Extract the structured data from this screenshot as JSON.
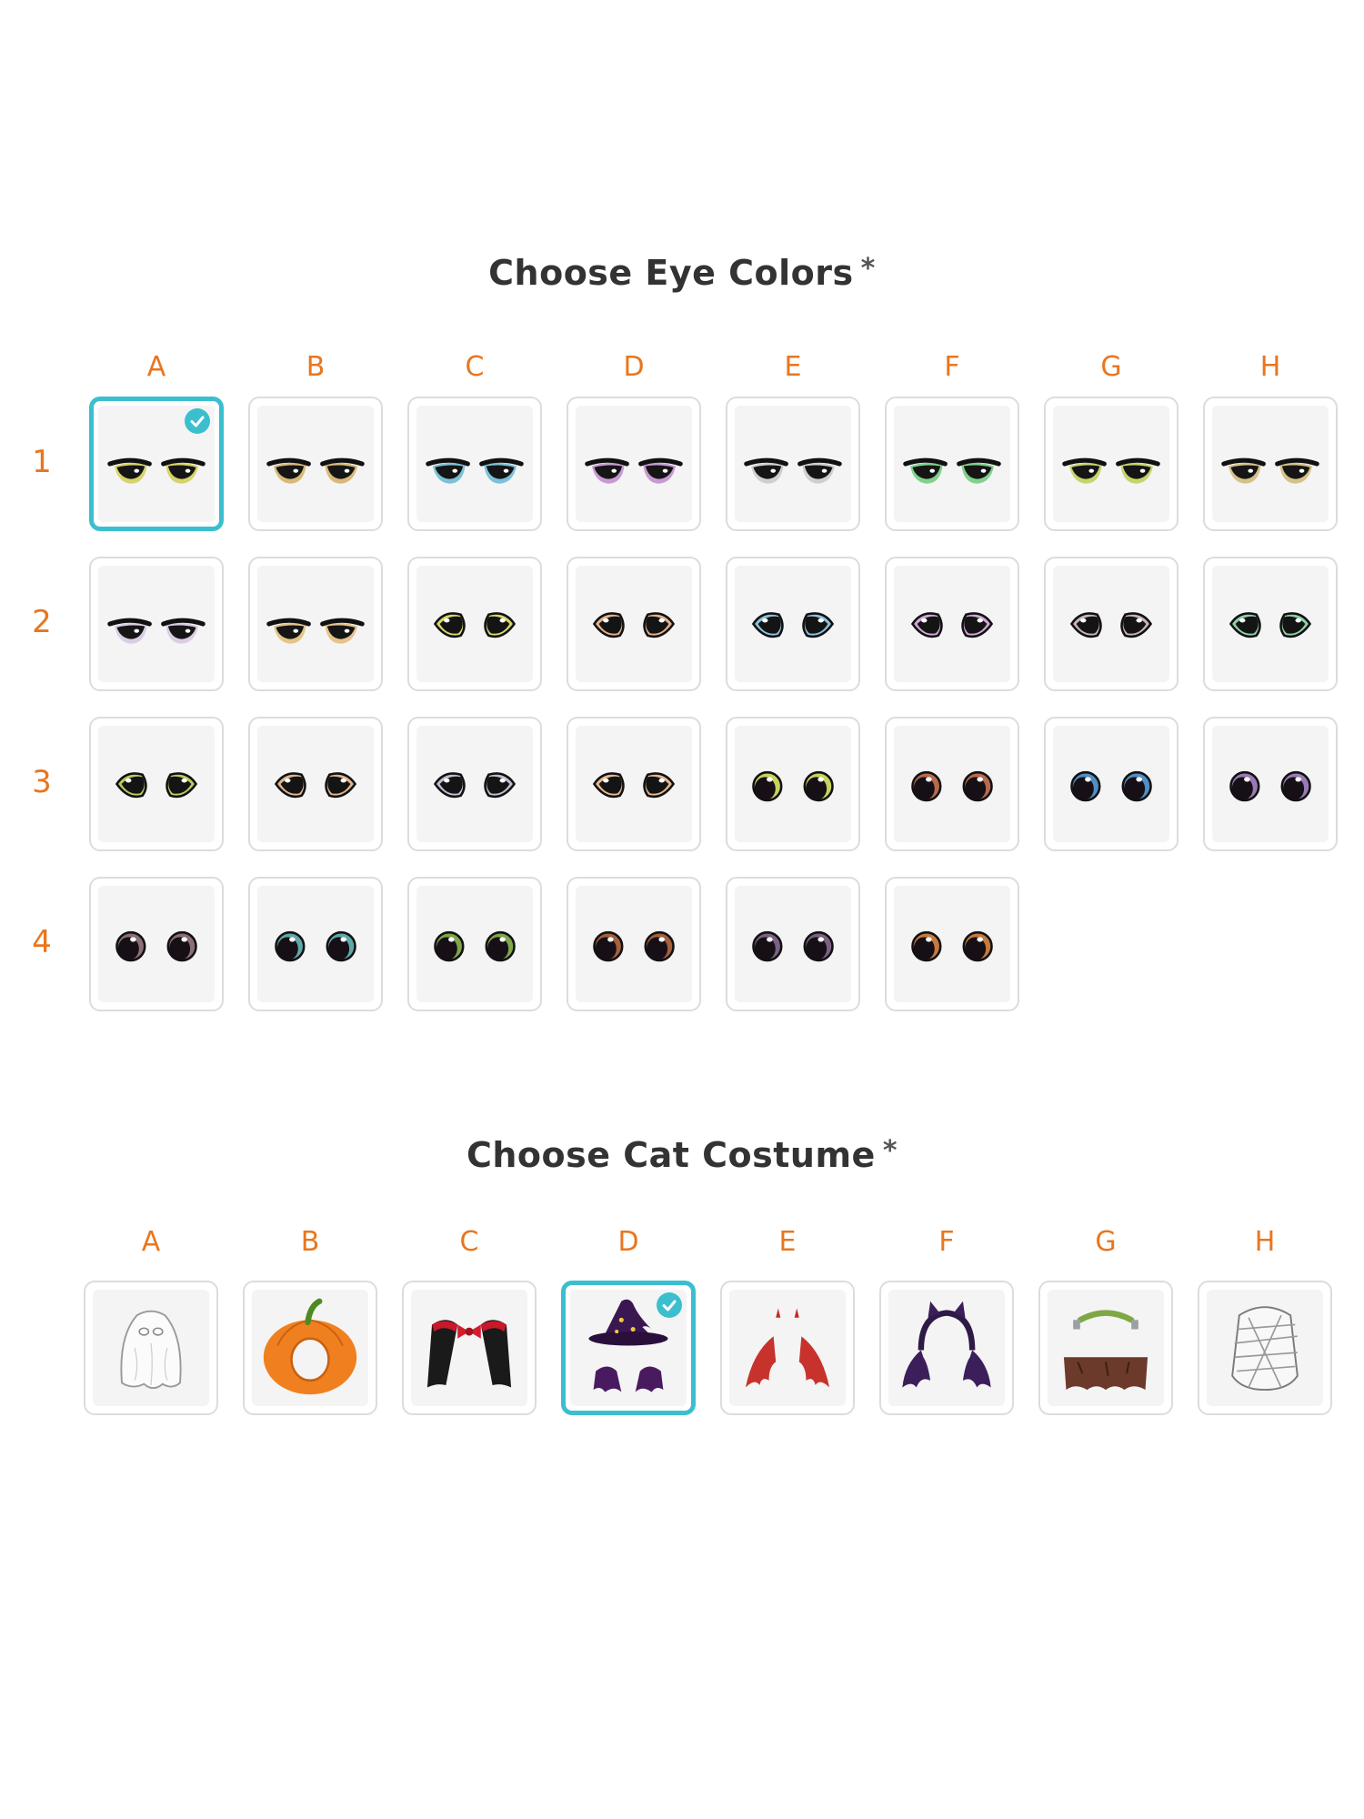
{
  "eyes": {
    "title": "Choose Eye Colors",
    "required_mark": "*",
    "columns": [
      "A",
      "B",
      "C",
      "D",
      "E",
      "F",
      "G",
      "H"
    ],
    "rows": [
      {
        "label": "1",
        "items": [
          {
            "style": "sleepy",
            "iris": "#d6d36a",
            "selected": true
          },
          {
            "style": "sleepy",
            "iris": "#d8b978"
          },
          {
            "style": "sleepy",
            "iris": "#7cc1d8"
          },
          {
            "style": "sleepy",
            "iris": "#c79ad3"
          },
          {
            "style": "sleepy",
            "iris": "#cfcfcf"
          },
          {
            "style": "sleepy",
            "iris": "#7fd18b"
          },
          {
            "style": "sleepy",
            "iris": "#c9d36c"
          },
          {
            "style": "sleepy",
            "iris": "#d6c18a"
          }
        ]
      },
      {
        "label": "2",
        "items": [
          {
            "style": "sleepy",
            "iris": "#d9cde3"
          },
          {
            "style": "sleepy",
            "iris": "#e4c48a"
          },
          {
            "style": "cat",
            "iris": "#d8d76a"
          },
          {
            "style": "cat",
            "iris": "#e6b28c"
          },
          {
            "style": "cat",
            "iris": "#8cc2dc"
          },
          {
            "style": "cat",
            "iris": "#d4a7d9"
          },
          {
            "style": "cat",
            "iris": "#c9b5b5"
          },
          {
            "style": "cat",
            "iris": "#8ed1a6"
          }
        ]
      },
      {
        "label": "3",
        "items": [
          {
            "style": "cat",
            "iris": "#b7cd60"
          },
          {
            "style": "cat",
            "iris": "#e0b58e"
          },
          {
            "style": "cat",
            "iris": "#c5bcd1"
          },
          {
            "style": "cat",
            "iris": "#e7b98e"
          },
          {
            "style": "round",
            "iris": "#c7d35e"
          },
          {
            "style": "round",
            "iris": "#b86a4c"
          },
          {
            "style": "round",
            "iris": "#4f8fc5"
          },
          {
            "style": "round",
            "iris": "#9a7ab6"
          }
        ]
      },
      {
        "label": "4",
        "items": [
          {
            "style": "round",
            "iris": "#8c6d78"
          },
          {
            "style": "round",
            "iris": "#5fa9a9"
          },
          {
            "style": "round",
            "iris": "#7fa64a"
          },
          {
            "style": "round",
            "iris": "#a4613c"
          },
          {
            "style": "round",
            "iris": "#7b6285"
          },
          {
            "style": "round",
            "iris": "#c77a3c"
          }
        ]
      }
    ]
  },
  "costume": {
    "title": "Choose Cat Costume",
    "required_mark": "*",
    "columns": [
      "A",
      "B",
      "C",
      "D",
      "E",
      "F",
      "G",
      "H"
    ],
    "items": [
      {
        "name": "ghost",
        "selected": false
      },
      {
        "name": "pumpkin",
        "selected": false
      },
      {
        "name": "vampire-cape",
        "selected": false
      },
      {
        "name": "witch-hat",
        "selected": true
      },
      {
        "name": "devil-wings",
        "selected": false
      },
      {
        "name": "bat-wings",
        "selected": false
      },
      {
        "name": "frankenstein",
        "selected": false
      },
      {
        "name": "mummy",
        "selected": false
      }
    ]
  }
}
